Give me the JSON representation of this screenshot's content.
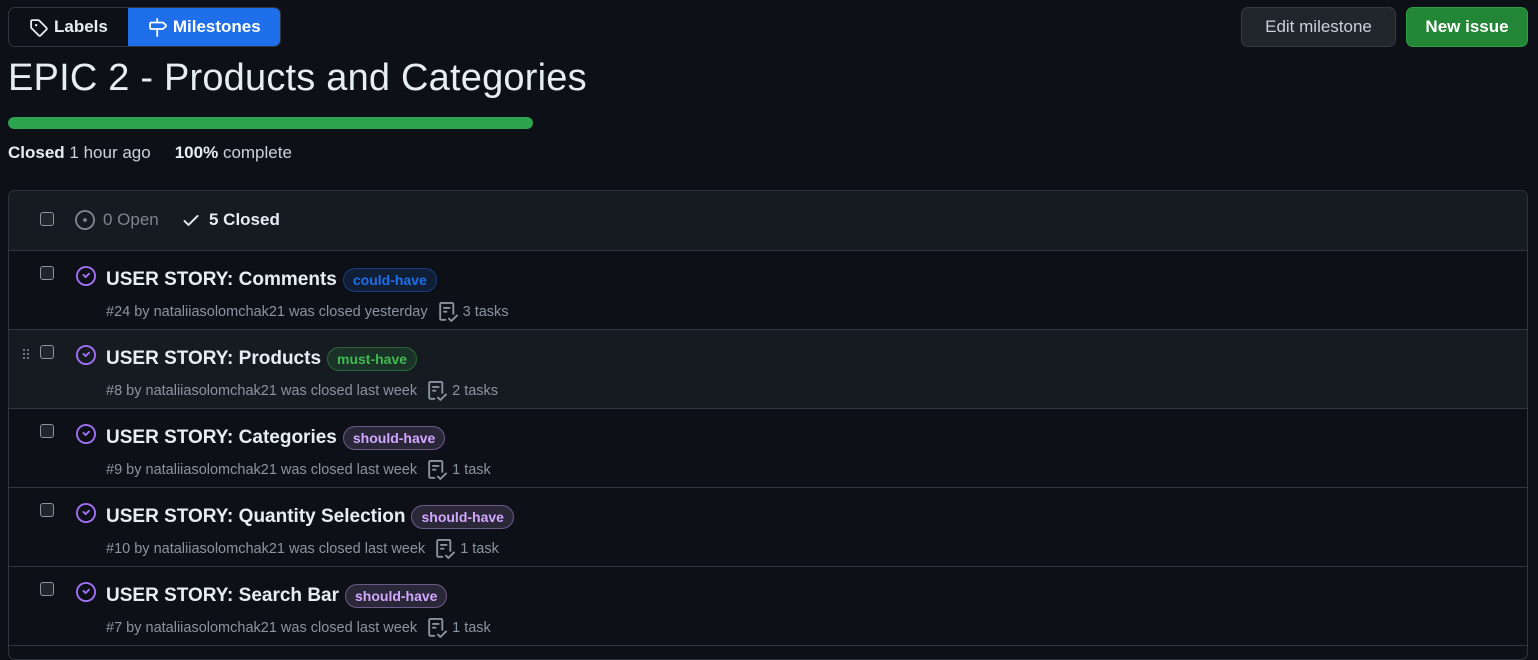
{
  "subnav": {
    "labels": "Labels",
    "milestones": "Milestones"
  },
  "actions": {
    "edit_milestone": "Edit milestone",
    "new_issue": "New issue"
  },
  "milestone": {
    "title": "EPIC 2 - Products and Categories",
    "progress_percent": 100,
    "closed_word": "Closed",
    "closed_time": "1 hour ago",
    "percent_text": "100%",
    "complete_word": "complete"
  },
  "filter": {
    "open": "0 Open",
    "closed": "5 Closed"
  },
  "issues": [
    {
      "title": "USER STORY: Comments",
      "label": "could-have",
      "label_color": "#1f6feb",
      "meta": "#24 by nataliiasolomchak21 was closed yesterday",
      "tasks": "3 tasks"
    },
    {
      "title": "USER STORY: Products",
      "label": "must-have",
      "label_color": "#3fb950",
      "meta": "#8 by nataliiasolomchak21 was closed last week",
      "tasks": "2 tasks"
    },
    {
      "title": "USER STORY: Categories",
      "label": "should-have",
      "label_color": "#d2a8ff",
      "meta": "#9 by nataliiasolomchak21 was closed last week",
      "tasks": "1 task"
    },
    {
      "title": "USER STORY: Quantity Selection",
      "label": "should-have",
      "label_color": "#d2a8ff",
      "meta": "#10 by nataliiasolomchak21 was closed last week",
      "tasks": "1 task"
    },
    {
      "title": "USER STORY: Search Bar",
      "label": "should-have",
      "label_color": "#d2a8ff",
      "meta": "#7 by nataliiasolomchak21 was closed last week",
      "tasks": "1 task"
    }
  ],
  "colors": {
    "accent_blue": "#1f6feb",
    "success_green": "#238636",
    "closed_purple": "#a371f7"
  }
}
